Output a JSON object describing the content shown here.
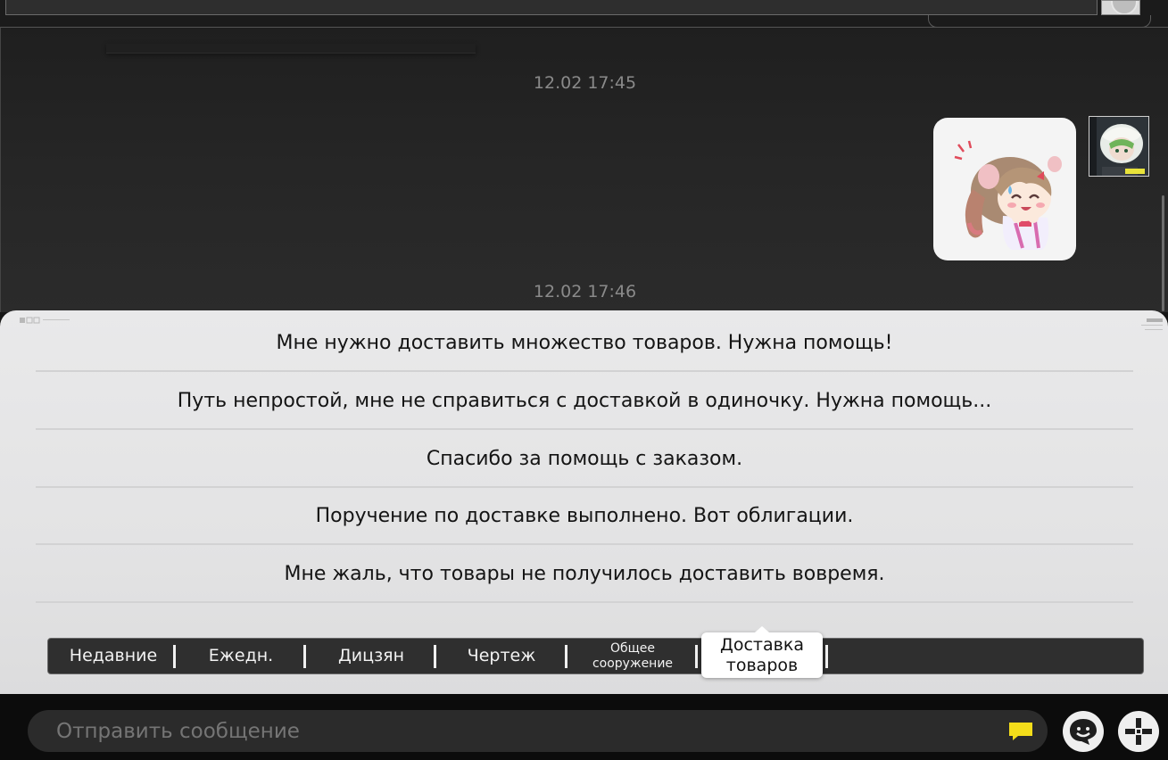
{
  "chat": {
    "timestamps": [
      "12.02 17:45",
      "12.02 17:46"
    ]
  },
  "top_bar": {
    "plus_label": "+"
  },
  "quick_replies": [
    "Мне нужно доставить множество товаров. Нужна помощь!",
    "Путь непростой, мне не справиться с доставкой в одиночку. Нужна помощь...",
    "Спасибо за помощь с заказом.",
    "Поручение по доставке выполнено. Вот облигации.",
    "Мне жаль, что товары не получилось доставить вовремя."
  ],
  "tabs": {
    "recent": "Недавние",
    "daily": "Ежедн.",
    "dizyan": "Дицзян",
    "blueprint": "Чертеж",
    "common_structure_line1": "Общее",
    "common_structure_line2": "сооружение",
    "delivery_line1": "Доставка",
    "delivery_line2": "товаров"
  },
  "input": {
    "placeholder": "Отправить сообщение"
  },
  "colors": {
    "accent_yellow": "#f3dd1a",
    "stripe_magenta": "#e03ad8",
    "stripe_yellow": "#e6d22a",
    "stripe_cyan": "#2fc8d8"
  },
  "icons": {
    "send_sticker": "chat-bubble-icon",
    "emoji": "smiley-icon",
    "more": "plus-icon"
  }
}
